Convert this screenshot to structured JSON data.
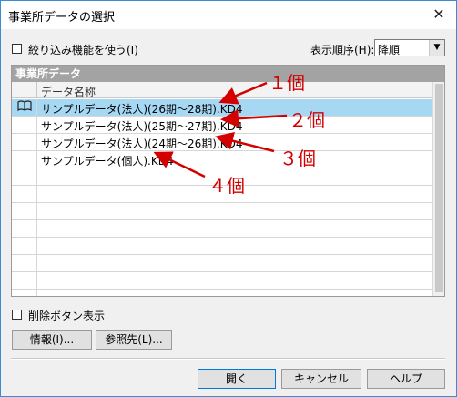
{
  "window": {
    "title": "事業所データの選択",
    "close_glyph": "✕"
  },
  "filter": {
    "label": "絞り込み機能を使う(I)",
    "checked": false
  },
  "sort": {
    "label": "表示順序(H):",
    "value": "降順"
  },
  "panel": {
    "title": "事業所データ",
    "column_header": "データ名称",
    "rows": [
      {
        "icon": "book-icon",
        "name": "サンプルデータ(法人)(26期～28期).KD4",
        "selected": true
      },
      {
        "icon": "",
        "name": "サンプルデータ(法人)(25期～27期).KD4",
        "selected": false
      },
      {
        "icon": "",
        "name": "サンプルデータ(法人)(24期～26期).KD4",
        "selected": false
      },
      {
        "icon": "",
        "name": "サンプルデータ(個人).KD4",
        "selected": false
      }
    ]
  },
  "delete_toggle": {
    "label": "削除ボタン表示",
    "checked": false
  },
  "buttons": {
    "info": "情報(I)...",
    "reference": "参照先(L)...",
    "open": "開く",
    "cancel": "キャンセル",
    "help": "ヘルプ"
  },
  "annotations": [
    "１個",
    "２個",
    "３個",
    "４個"
  ],
  "colors": {
    "selected_row": "#a7d8f3",
    "annotation": "#d40000",
    "panel_header": "#a3a3a3"
  }
}
